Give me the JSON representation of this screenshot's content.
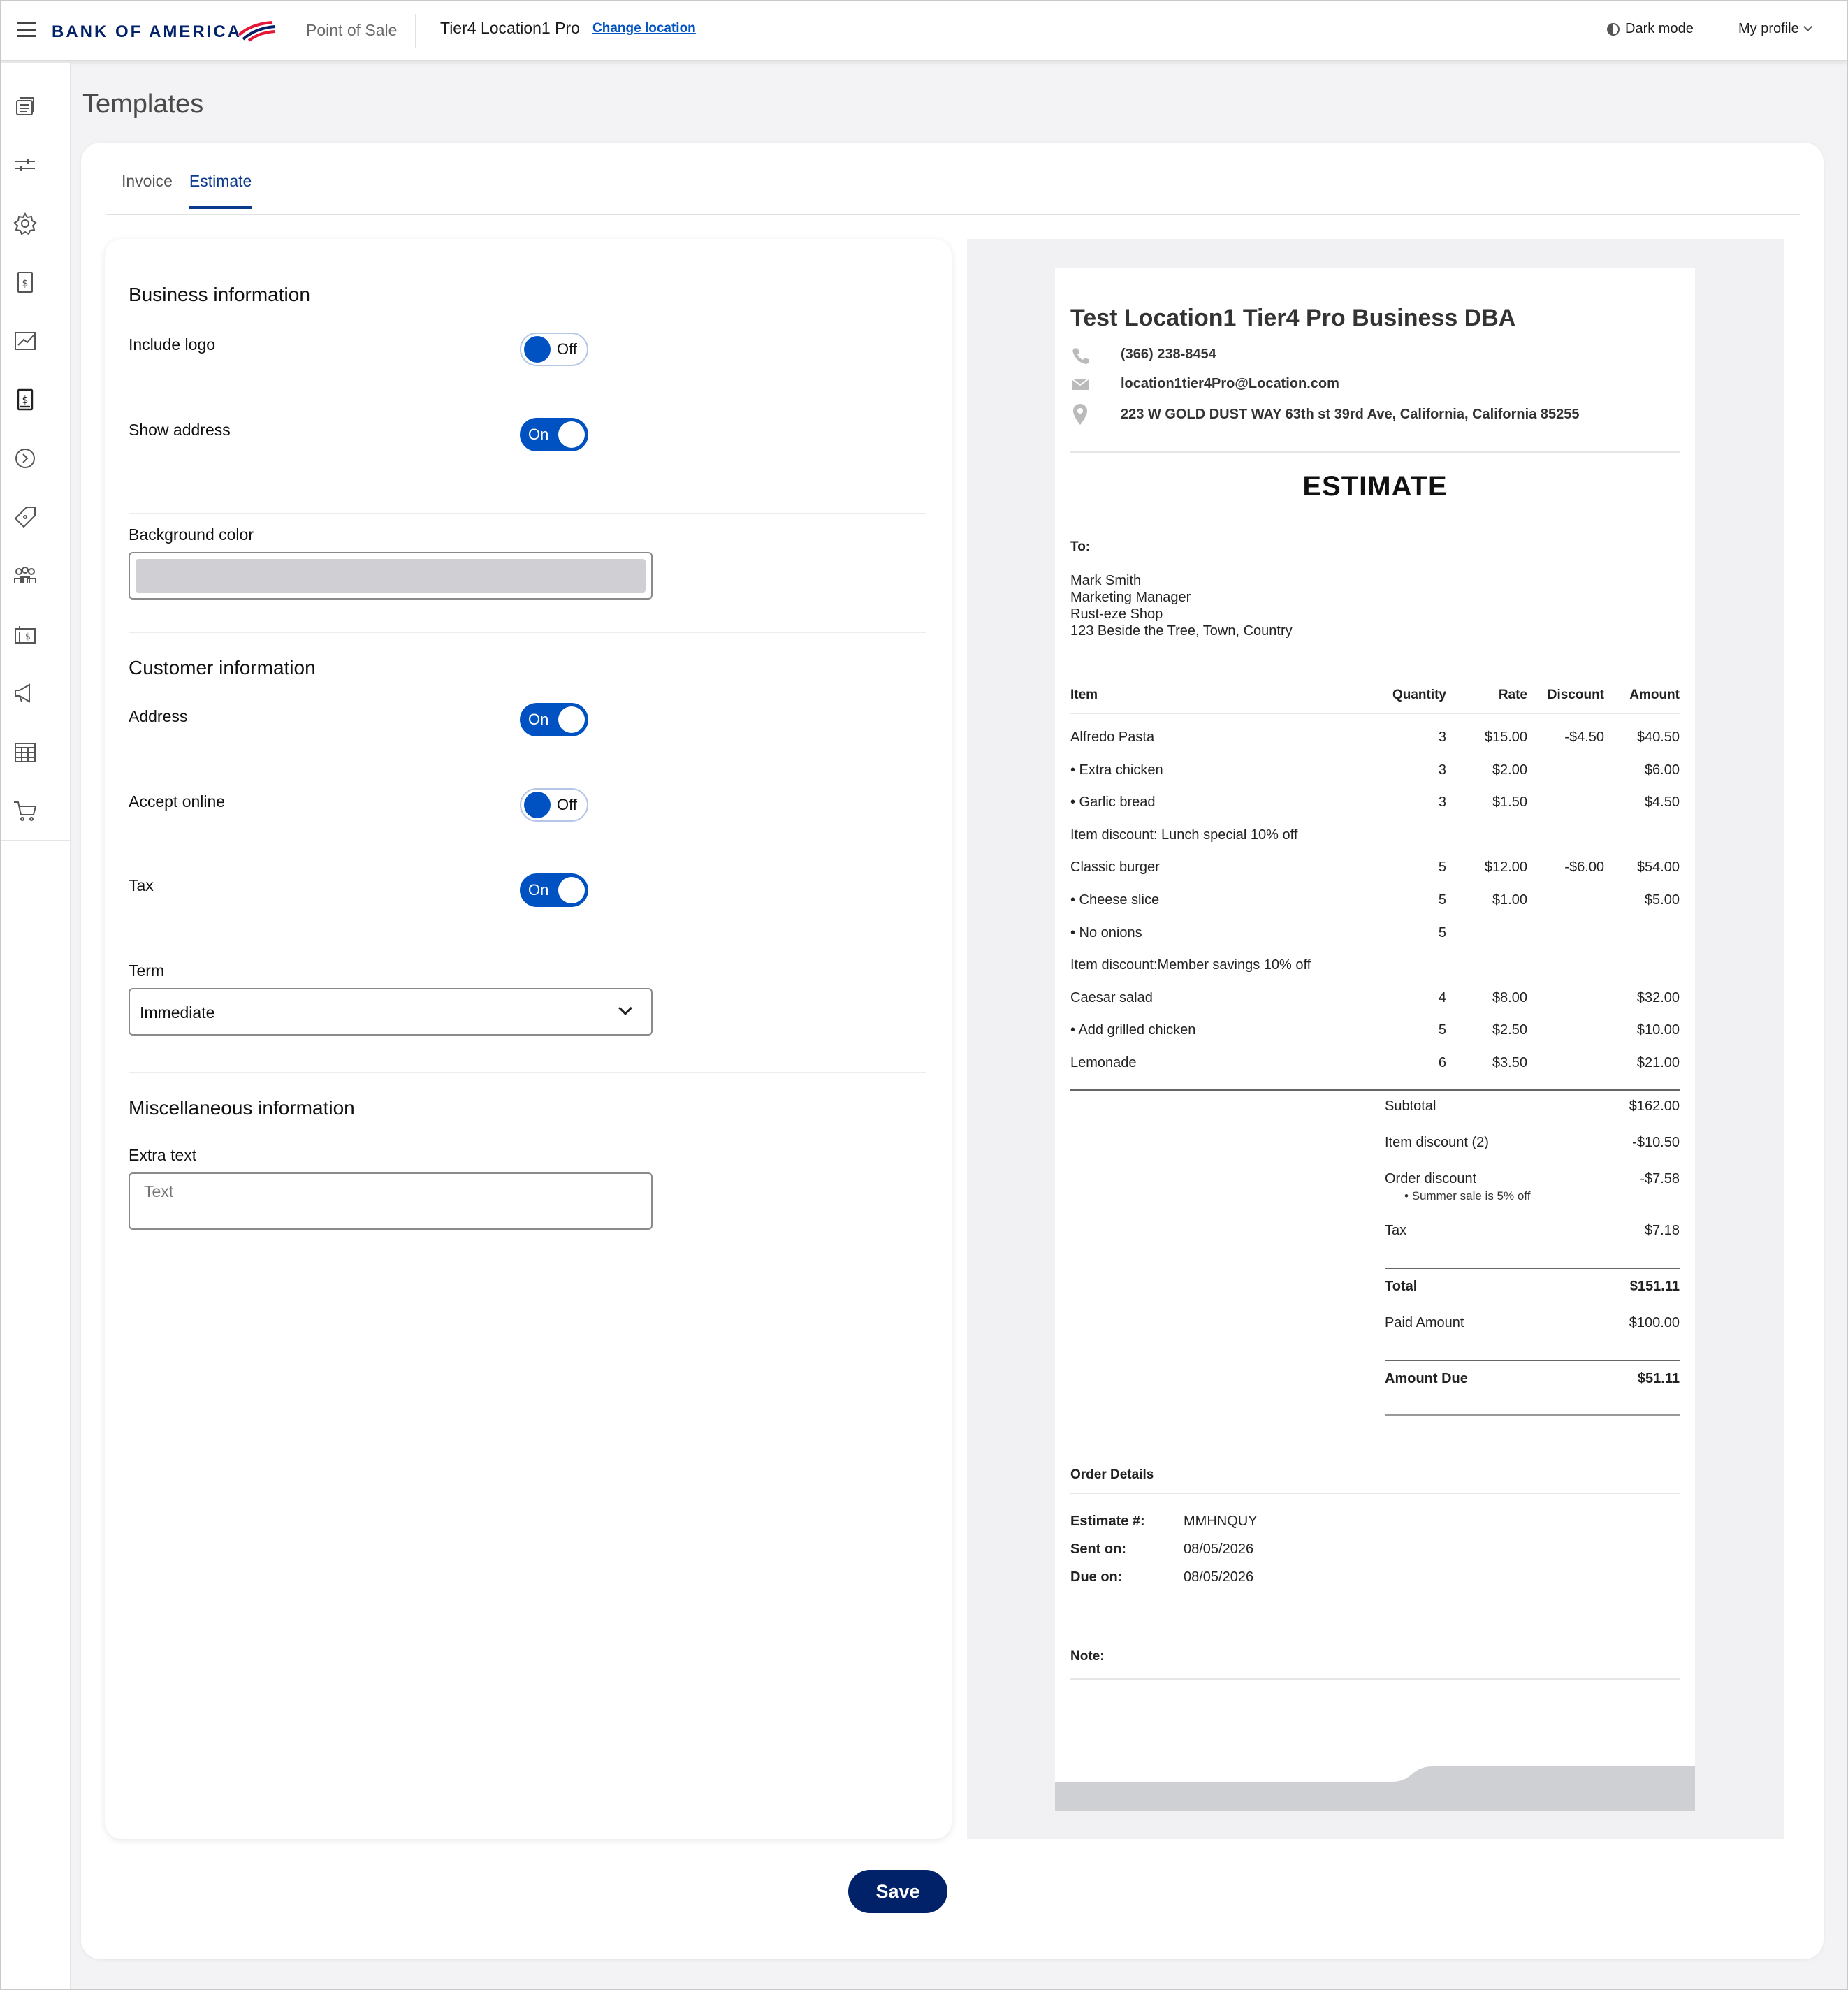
{
  "header": {
    "brand": "BANK OF AMERICA",
    "product": "Point of Sale",
    "location": "Tier4 Location1 Pro",
    "change_location": "Change location",
    "dark_mode": "Dark mode",
    "profile": "My profile"
  },
  "sidebar": {
    "icons": [
      "transactions-icon",
      "sliders-icon",
      "gear-icon",
      "invoice-icon",
      "reports-icon",
      "estimate-icon",
      "tips-icon",
      "discounts-icon",
      "customers-icon",
      "gift-card-icon",
      "marketing-icon",
      "calendar-icon",
      "cart-icon"
    ]
  },
  "page": {
    "title": "Templates"
  },
  "tabs": [
    {
      "label": "Invoice",
      "active": false
    },
    {
      "label": "Estimate",
      "active": true
    }
  ],
  "settings": {
    "business": {
      "title": "Business information",
      "include_logo": {
        "label": "Include logo",
        "state": "Off"
      },
      "show_address": {
        "label": "Show address",
        "state": "On"
      },
      "background_color": {
        "label": "Background color",
        "value": "#d0d0d4"
      }
    },
    "customer": {
      "title": "Customer information",
      "address": {
        "label": "Address",
        "state": "On"
      },
      "accept_online": {
        "label": "Accept online",
        "state": "Off"
      },
      "tax": {
        "label": "Tax",
        "state": "On"
      },
      "term": {
        "label": "Term",
        "value": "Immediate"
      }
    },
    "misc": {
      "title": "Miscellaneous information",
      "extra_text": {
        "label": "Extra text",
        "placeholder": "Text"
      }
    }
  },
  "preview": {
    "business_name": "Test Location1 Tier4 Pro Business DBA",
    "phone": "(366) 238-8454",
    "email": "location1tier4Pro@Location.com",
    "address": "223 W GOLD DUST WAY 63th st 39rd Ave, California, California 85255",
    "doc_title": "ESTIMATE",
    "to_label": "To:",
    "recipient": {
      "name": "Mark Smith",
      "title": "Marketing Manager",
      "company": "Rust-eze Shop",
      "address": "123 Beside the Tree, Town, Country"
    },
    "columns": {
      "item": "Item",
      "quantity": "Quantity",
      "rate": "Rate",
      "discount": "Discount",
      "amount": "Amount"
    },
    "rows": [
      {
        "item": "Alfredo Pasta",
        "qty": "3",
        "rate": "$15.00",
        "disc": "-$4.50",
        "amt": "$40.50"
      },
      {
        "item": "• Extra chicken",
        "qty": "3",
        "rate": "$2.00",
        "disc": "",
        "amt": "$6.00"
      },
      {
        "item": "• Garlic bread",
        "qty": "3",
        "rate": "$1.50",
        "disc": "",
        "amt": "$4.50"
      },
      {
        "item": "Item discount: Lunch special 10% off",
        "qty": "",
        "rate": "",
        "disc": "",
        "amt": ""
      },
      {
        "item": "Classic burger",
        "qty": "5",
        "rate": "$12.00",
        "disc": "-$6.00",
        "amt": "$54.00"
      },
      {
        "item": "• Cheese slice",
        "qty": "5",
        "rate": "$1.00",
        "disc": "",
        "amt": "$5.00"
      },
      {
        "item": "• No onions",
        "qty": "5",
        "rate": "",
        "disc": "",
        "amt": ""
      },
      {
        "item": "Item discount:Member savings 10% off",
        "qty": "",
        "rate": "",
        "disc": "",
        "amt": ""
      },
      {
        "item": "Caesar salad",
        "qty": "4",
        "rate": "$8.00",
        "disc": "",
        "amt": "$32.00"
      },
      {
        "item": "• Add grilled chicken",
        "qty": "5",
        "rate": "$2.50",
        "disc": "",
        "amt": "$10.00"
      },
      {
        "item": "Lemonade",
        "qty": "6",
        "rate": "$3.50",
        "disc": "",
        "amt": "$21.00"
      }
    ],
    "totals": {
      "subtotal_label": "Subtotal",
      "subtotal": "$162.00",
      "item_discount_label": "Item discount (2)",
      "item_discount": "-$10.50",
      "order_discount_label": "Order discount",
      "order_discount": "-$7.58",
      "order_discount_note": "Summer sale is 5% off",
      "tax_label": "Tax",
      "tax": "$7.18",
      "total_label": "Total",
      "total": "$151.11",
      "paid_label": "Paid Amount",
      "paid": "$100.00",
      "due_label": "Amount Due",
      "due": "$51.11"
    },
    "order_details": {
      "title": "Order Details",
      "estimate_label": "Estimate #:",
      "estimate": "MMHNQUY",
      "sent_label": "Sent on:",
      "sent": "08/05/2026",
      "due_label": "Due on:",
      "due": "08/05/2026"
    },
    "note_label": "Note:"
  },
  "actions": {
    "save": "Save"
  },
  "colors": {
    "brand_navy": "#012169",
    "accent_blue": "#0052c2",
    "brand_red": "#e31837"
  }
}
